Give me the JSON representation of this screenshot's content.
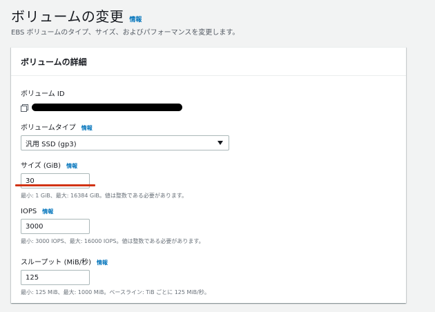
{
  "page": {
    "title": "ボリュームの変更",
    "title_info": "情報",
    "description": "EBS ボリュームのタイプ、サイズ、およびパフォーマンスを変更します。"
  },
  "panel": {
    "header": "ボリュームの詳細",
    "volume_id": {
      "label": "ボリューム ID"
    },
    "volume_type": {
      "label": "ボリュームタイプ",
      "info": "情報",
      "selected": "汎用 SSD (gp3)"
    },
    "size": {
      "label": "サイズ (GiB)",
      "info": "情報",
      "value": "30",
      "hint": "最小: 1 GiB、最大: 16384 GiB。値は整数である必要があります。"
    },
    "iops": {
      "label": "IOPS",
      "info": "情報",
      "value": "3000",
      "hint": "最小: 3000 IOPS、最大: 16000 IOPS。値は整数である必要があります。"
    },
    "throughput": {
      "label": "スループット (MiB/秒)",
      "info": "情報",
      "value": "125",
      "hint": "最小: 125 MiB、最大: 1000 MiB。ベースライン: TiB ごとに 125 MiB/秒。"
    }
  },
  "colors": {
    "link": "#0073bb",
    "annotation": "#d13212",
    "background": "#f2f3f3"
  },
  "icons": {
    "copy": "copy-icon",
    "dropdown": "caret-down-icon"
  }
}
